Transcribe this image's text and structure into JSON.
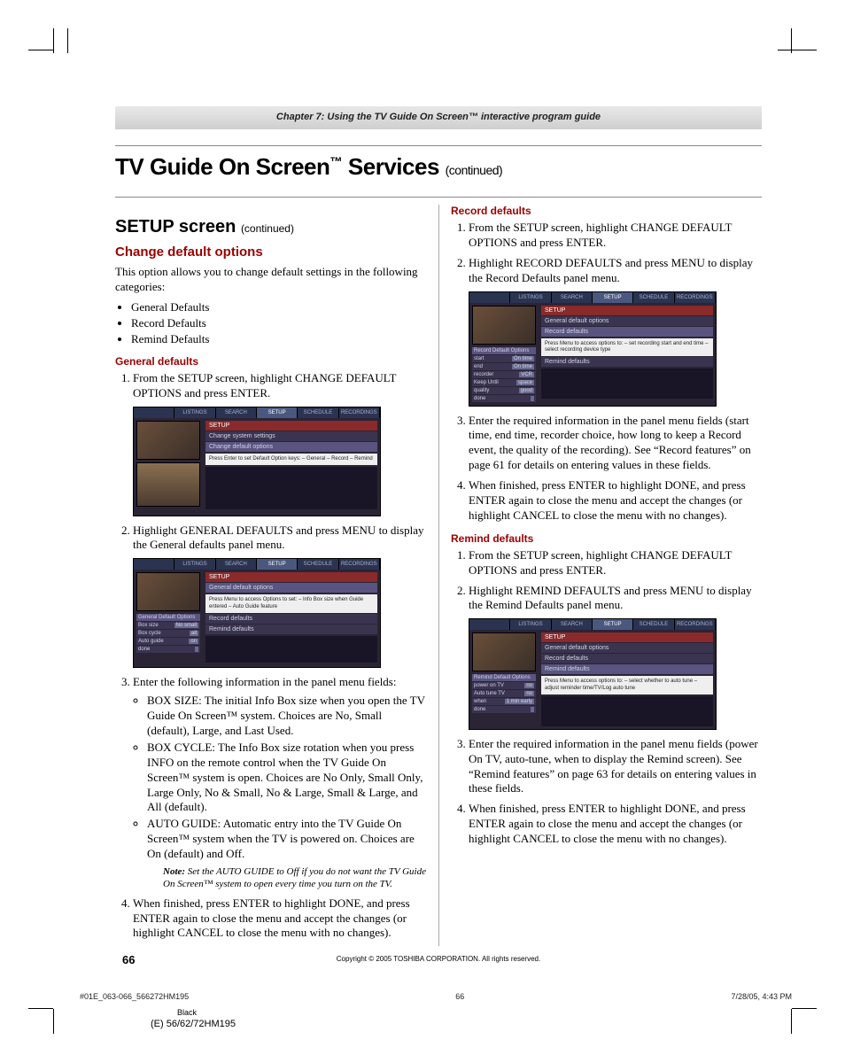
{
  "chapter_bar": "Chapter 7: Using the TV Guide On Screen™ interactive program guide",
  "title": {
    "main": "TV Guide On Screen",
    "suffix": " Services ",
    "cont": "(continued)"
  },
  "section": {
    "main": "SETUP screen ",
    "cont": "(continued)"
  },
  "subheading": "Change default options",
  "intro": "This option allows you to change default settings in the following categories:",
  "categories": [
    "General Defaults",
    "Record Defaults",
    "Remind Defaults"
  ],
  "general": {
    "heading": "General defaults",
    "steps": {
      "s1": "From the SETUP screen, highlight CHANGE DEFAULT OPTIONS and press ENTER.",
      "s2": "Highlight GENERAL DEFAULTS and press MENU to display the General defaults panel menu.",
      "s3": "Enter the following information in the panel menu fields:",
      "s3_items": {
        "a": "BOX SIZE: The initial Info Box size when you open the TV Guide On Screen™ system. Choices are No, Small (default), Large, and Last Used.",
        "b": "BOX CYCLE: The Info Box size rotation when you press INFO on the remote control when the TV Guide On Screen™ system is open. Choices are No Only, Small Only, Large Only, No & Small, No & Large, Small & Large, and All (default).",
        "c": "AUTO GUIDE: Automatic entry into the TV Guide On Screen™ system when the TV is powered on. Choices are On (default) and Off."
      },
      "note_label": "Note:",
      "note": " Set the AUTO GUIDE to Off if you do not want the TV Guide On Screen™ system to open every time you turn on the TV.",
      "s4": "When finished, press ENTER to highlight DONE, and press ENTER again to close the menu and accept the changes (or highlight CANCEL to close the menu with no changes)."
    }
  },
  "record": {
    "heading": "Record defaults",
    "s1": "From the SETUP screen, highlight CHANGE DEFAULT OPTIONS and press ENTER.",
    "s2": "Highlight RECORD DEFAULTS and press MENU to display the Record Defaults panel menu.",
    "s3": "Enter the required information in the panel menu fields (start time, end time, recorder choice, how long to keep a Record event, the quality of the recording). See “Record features” on page 61 for details on entering values in these fields.",
    "s4": "When finished, press ENTER to highlight DONE, and press ENTER again to close the menu and accept the changes (or highlight CANCEL to close the menu with no changes)."
  },
  "remind": {
    "heading": "Remind defaults",
    "s1": "From the SETUP screen, highlight CHANGE DEFAULT OPTIONS and press ENTER.",
    "s2": "Highlight REMIND DEFAULTS and press MENU to display the Remind Defaults panel menu.",
    "s3": "Enter the required information in the panel menu fields (power On TV, auto-tune, when to display the Remind screen). See “Remind features” on page 63 for details on entering values in these fields.",
    "s4": "When finished, press ENTER to highlight DONE, and press ENTER again to close the menu and accept the changes (or highlight CANCEL to close the menu with no changes)."
  },
  "shots": {
    "tabs": [
      "LISTINGS",
      "SEARCH",
      "",
      "SCHEDULE",
      "RECORDINGS"
    ],
    "setup_tab": "SETUP",
    "shot1": {
      "h1": "SETUP",
      "h2": "Change system settings",
      "h3": "Change default options",
      "info": "Press Enter to set Default Option keys:\n– General\n– Record\n– Remind"
    },
    "shot2": {
      "h1": "SETUP",
      "h2": "General default options",
      "info": "Press Menu to access Options to set:\n– Info Box size when Guide entered\n– Auto Guide feature",
      "rows": [
        [
          "Box size",
          "No small"
        ],
        [
          "Box cycle",
          "all"
        ],
        [
          "Auto guide",
          "on"
        ],
        [
          "done",
          ""
        ]
      ],
      "side_label": "General Default Options",
      "extra1": "Record defaults",
      "extra2": "Remind defaults"
    },
    "shot3": {
      "h1": "SETUP",
      "h2": "General default options",
      "h3": "Record defaults",
      "info": "Press Menu to access options to:\n– set recording start and end time\n– select recording device type",
      "rows": [
        [
          "start",
          "On time"
        ],
        [
          "end",
          "On time"
        ],
        [
          "recorder",
          "VCR"
        ],
        [
          "Keep Until",
          "space"
        ],
        [
          "quality",
          "good"
        ],
        [
          "done",
          ""
        ]
      ],
      "side_label": "Record Default Options",
      "extra1": "Remind defaults"
    },
    "shot4": {
      "h1": "SETUP",
      "h2": "General default options",
      "h3": "Record defaults",
      "h4": "Remind defaults",
      "info": "Press Menu to access options to:\n– select whether to auto tune\n– adjust reminder time/TV/Log auto tune",
      "rows": [
        [
          "power on TV",
          "no"
        ],
        [
          "Auto tune TV",
          "no"
        ],
        [
          "when",
          "1 min early"
        ],
        [
          "done",
          ""
        ]
      ],
      "side_label": "Remind Default Options"
    }
  },
  "footer": {
    "page": "66",
    "copyright": "Copyright © 2005 TOSHIBA CORPORATION. All rights reserved."
  },
  "printline": {
    "left": "#01E_063-066_566272HM195",
    "mid": "66",
    "right": "7/28/05, 4:43 PM"
  },
  "color_sep": "Black",
  "model": "(E) 56/62/72HM195"
}
